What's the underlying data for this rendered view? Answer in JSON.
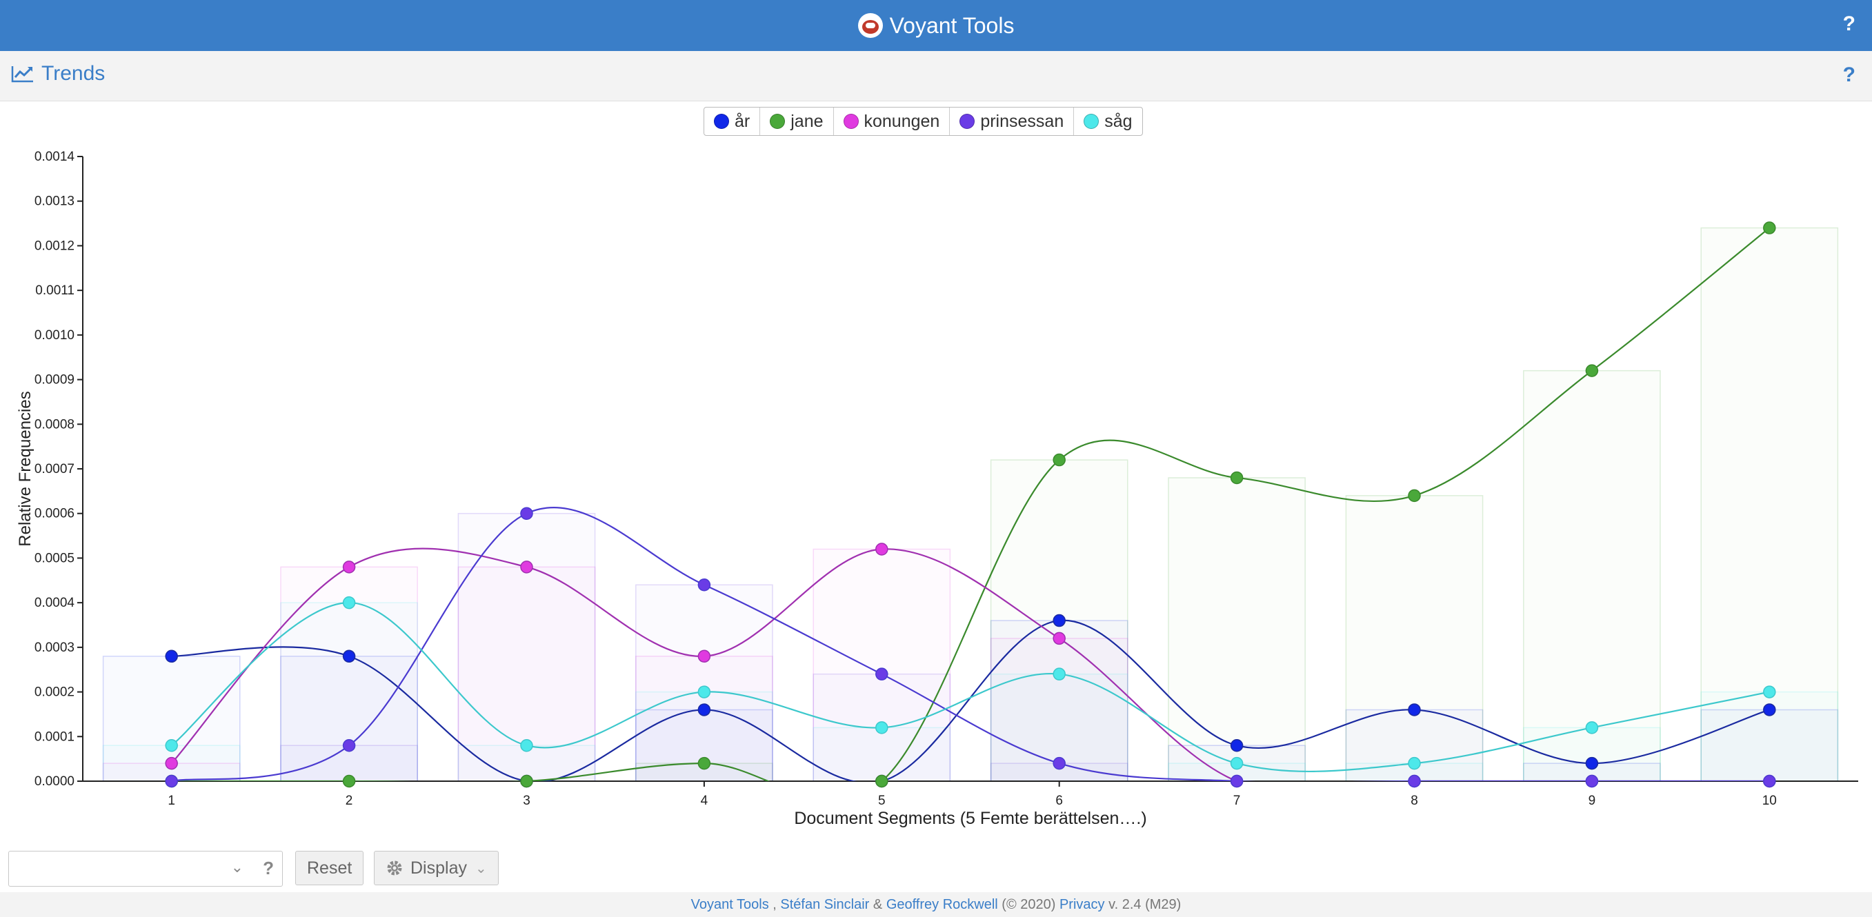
{
  "app": {
    "title": "Voyant Tools",
    "help": "?"
  },
  "panel": {
    "title": "Trends",
    "help": "?"
  },
  "controls": {
    "reset_label": "Reset",
    "display_label": "Display",
    "help": "?"
  },
  "footer": {
    "link1": "Voyant Tools",
    "sep1": " , ",
    "author1": "Stéfan Sinclair",
    "amp": " & ",
    "author2": "Geoffrey Rockwell",
    "year": " (© 2020) ",
    "privacy": "Privacy",
    "version": " v. 2.4 (M29)"
  },
  "colors": {
    "topbar": "#3a7ec8",
    "ar": "#1027e8",
    "jane": "#4aa83a",
    "konungen": "#e03ae0",
    "prinsessan": "#6a3ce6",
    "sag": "#4de8ea"
  },
  "chart_data": {
    "type": "line",
    "xlabel": "Document Segments (5 Femte berättelsen….)",
    "ylabel": "Relative Frequencies",
    "ylim": [
      0,
      0.0014
    ],
    "yticks": [
      "0.0000",
      "0.0001",
      "0.0002",
      "0.0003",
      "0.0004",
      "0.0005",
      "0.0006",
      "0.0007",
      "0.0008",
      "0.0009",
      "0.0010",
      "0.0011",
      "0.0012",
      "0.0013",
      "0.0014"
    ],
    "categories": [
      "1",
      "2",
      "3",
      "4",
      "5",
      "6",
      "7",
      "8",
      "9",
      "10"
    ],
    "legend_position": "top-center",
    "series": [
      {
        "name": "år",
        "color": "#1027e8",
        "line": "#1a2aa0",
        "values": [
          0.00028,
          0.00028,
          0.0,
          0.00016,
          0.0,
          0.00036,
          8e-05,
          0.00016,
          4e-05,
          0.00016
        ]
      },
      {
        "name": "jane",
        "color": "#4aa83a",
        "line": "#3a8a2c",
        "values": [
          0.0,
          0.0,
          0.0,
          4e-05,
          0.0,
          0.00072,
          0.00068,
          0.00064,
          0.00092,
          0.00124
        ]
      },
      {
        "name": "konungen",
        "color": "#e03ae0",
        "line": "#a030b0",
        "values": [
          4e-05,
          0.00048,
          0.00048,
          0.00028,
          0.00052,
          0.00032,
          0.0,
          0.0,
          0.0,
          0.0
        ]
      },
      {
        "name": "prinsessan",
        "color": "#6a3ce6",
        "line": "#4a3ad0",
        "values": [
          0.0,
          8e-05,
          0.0006,
          0.00044,
          0.00024,
          4e-05,
          0.0,
          0.0,
          0.0,
          0.0
        ]
      },
      {
        "name": "såg",
        "color": "#4de8ea",
        "line": "#3cc8cc",
        "values": [
          8e-05,
          0.0004,
          8e-05,
          0.0002,
          0.00012,
          0.00024,
          4e-05,
          4e-05,
          0.00012,
          0.0002
        ]
      }
    ]
  }
}
